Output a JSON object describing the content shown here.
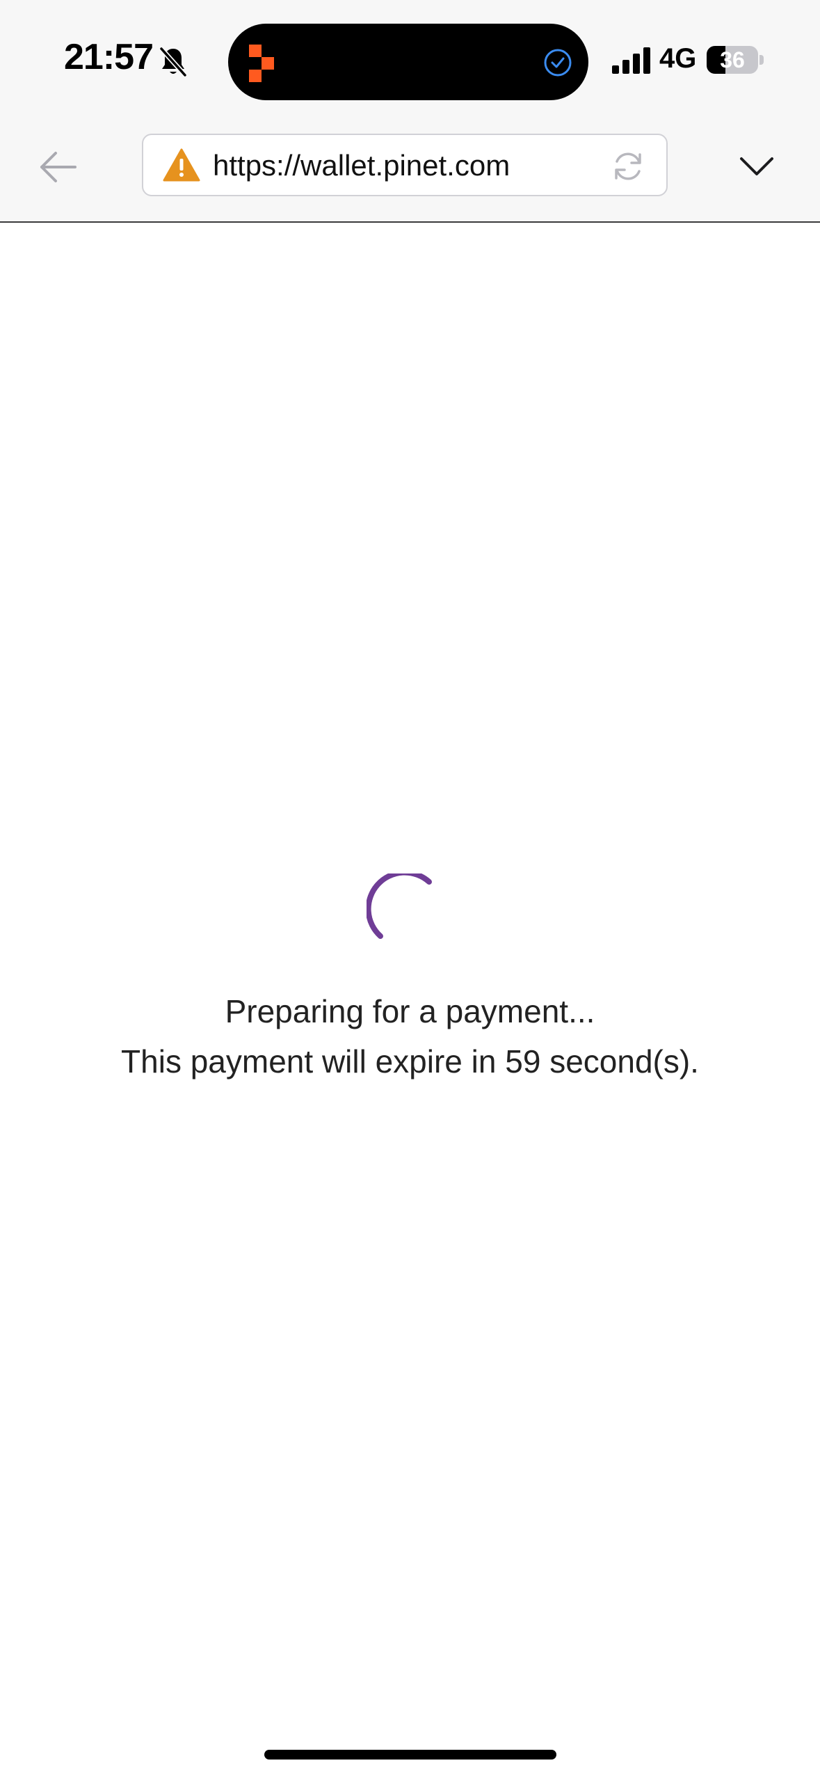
{
  "status_bar": {
    "time": "21:57",
    "network": "4G",
    "battery_level": "36",
    "battery_fraction": 0.36,
    "icons": [
      "bell-off-icon",
      "app-logo-icon",
      "check-circle-icon",
      "signal-icon",
      "battery-icon"
    ]
  },
  "browser": {
    "url": "https://wallet.pinet.com",
    "icons": [
      "back-arrow-icon",
      "warning-icon",
      "reload-icon",
      "chevron-down-icon"
    ]
  },
  "content": {
    "status_message": "Preparing for a payment...",
    "expiry_message": "This payment will expire in 59 second(s).",
    "icons": [
      "spinner-icon"
    ]
  },
  "colors": {
    "accent": "#6f3d96",
    "warning": "#e6921e",
    "app_logo": "#ff5a1f",
    "island_check": "#3b8cf0"
  }
}
